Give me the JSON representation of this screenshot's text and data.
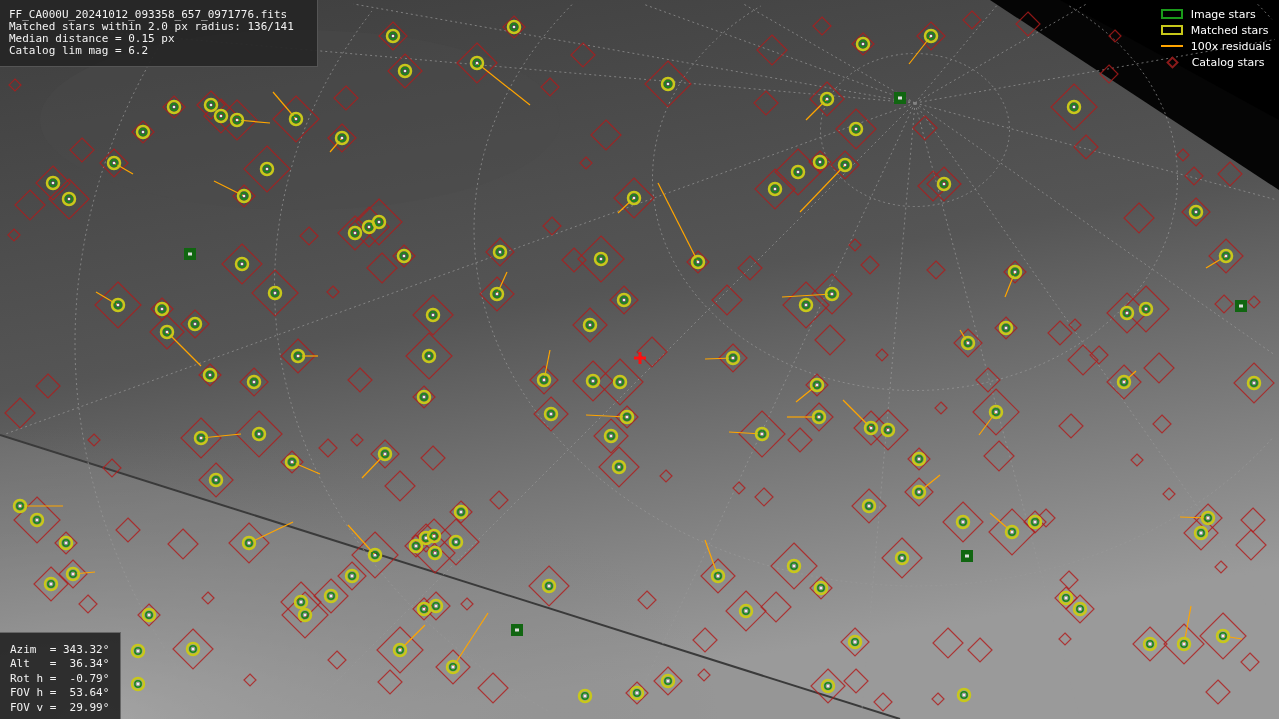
{
  "file_info": {
    "lines": [
      "FF_CA000U_20241012_093358_657_0971776.fits",
      "Matched stars within 2.0 px radius: 136/141",
      "Median distance = 0.15 px",
      "Catalog lim mag = 6.2"
    ]
  },
  "legend": {
    "items": [
      {
        "kind": "box",
        "label": "Image stars",
        "color": "#1a9a1a"
      },
      {
        "kind": "box",
        "label": "Matched stars",
        "color": "#c8c81a"
      },
      {
        "kind": "line",
        "label": "100x residuals",
        "color": "#ffa500"
      },
      {
        "kind": "diamond",
        "label": "Catalog stars",
        "color": "#8a1a1a"
      }
    ]
  },
  "pointing": {
    "lines": [
      "Azim  = 343.32°",
      "Alt   =  36.34°",
      "Rot h =  -0.79°",
      "FOV h =  53.64°",
      "FOV v =  29.99°"
    ]
  }
}
